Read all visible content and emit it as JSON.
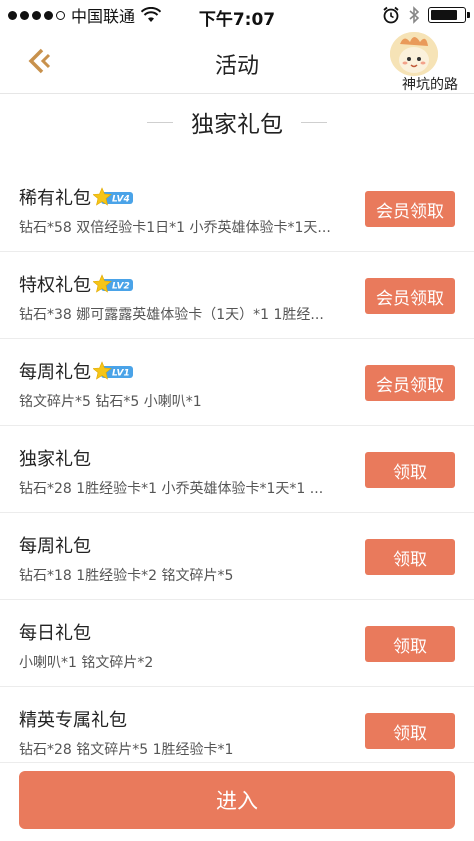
{
  "status_bar": {
    "carrier": "中国联通",
    "time": "下午7:07"
  },
  "nav": {
    "title": "活动",
    "user_name": "神坑的路"
  },
  "section": {
    "title": "独家礼包"
  },
  "gifts": [
    {
      "name": "稀有礼包",
      "badge": "LV4",
      "desc": "钻石*58 双倍经验卡1日*1 小乔英雄体验卡*1天...",
      "button": "会员领取"
    },
    {
      "name": "特权礼包",
      "badge": "LV2",
      "desc": "钻石*38 娜可露露英雄体验卡（1天）*1 1胜经...",
      "button": "会员领取"
    },
    {
      "name": "每周礼包",
      "badge": "LV1",
      "desc": "铭文碎片*5 钻石*5 小喇叭*1",
      "button": "会员领取"
    },
    {
      "name": "独家礼包",
      "badge": "",
      "desc": "钻石*28 1胜经验卡*1 小乔英雄体验卡*1天*1 ...",
      "button": "领取"
    },
    {
      "name": "每周礼包",
      "badge": "",
      "desc": "钻石*18 1胜经验卡*2 铭文碎片*5",
      "button": "领取"
    },
    {
      "name": "每日礼包",
      "badge": "",
      "desc": "小喇叭*1 铭文碎片*2",
      "button": "领取"
    },
    {
      "name": "精英专属礼包",
      "badge": "",
      "desc": "钻石*28 铭文碎片*5 1胜经验卡*1",
      "button": "领取"
    }
  ],
  "bottom": {
    "enter_label": "进入"
  },
  "colors": {
    "accent": "#e97a5c",
    "back_arrow": "#c8914c",
    "badge_blue": "#4aa3e8",
    "badge_star": "#f5c518"
  },
  "icons": {
    "back": "back-arrow-icon",
    "wifi": "wifi-icon",
    "alarm": "alarm-icon",
    "bluetooth": "bluetooth-icon",
    "battery": "battery-icon",
    "vip_badge": "vip-level-badge-icon"
  }
}
